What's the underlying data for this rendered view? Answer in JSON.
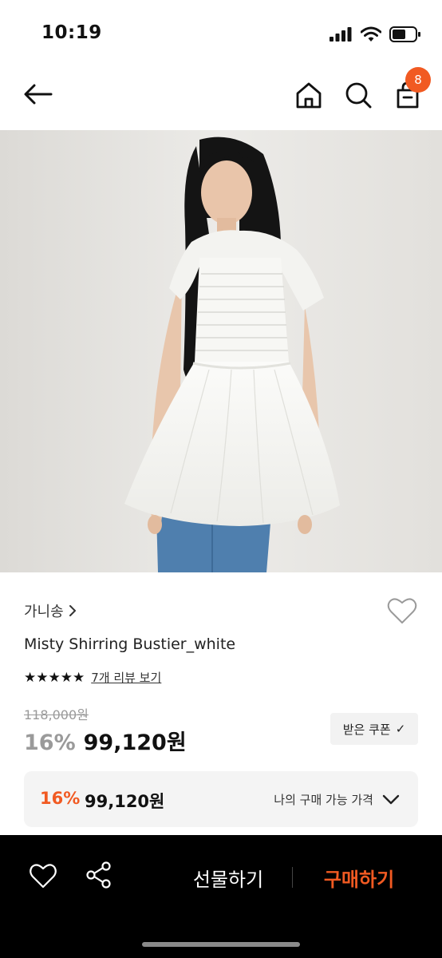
{
  "status_bar": {
    "time": "10:19",
    "icons": [
      "signal-icon",
      "wifi-icon",
      "battery-icon"
    ]
  },
  "nav": {
    "icons": [
      "back-arrow-icon",
      "home-icon",
      "search-icon",
      "shopping-bag-icon"
    ],
    "cart_count": "8"
  },
  "product": {
    "image_label": "product-photo",
    "brand": "가니송",
    "name": "Misty Shirring Bustier_white",
    "rating_stars": "★★★★★",
    "review_link": "7개 리뷰 보기",
    "original_price": "118,000원",
    "discount": "16%",
    "sale_price": "99,120원",
    "coupon_label": "받은 쿠폰",
    "coupon_check": "✓"
  },
  "my_price": {
    "discount": "16%",
    "price": "99,120원",
    "label": "나의 구매 가능 가격"
  },
  "bottom_bar": {
    "gift_label": "선물하기",
    "buy_label": "구매하기"
  },
  "colors": {
    "accent": "#f15a22",
    "bottom_bar_bg": "#000000",
    "muted_text": "#9a9a9a"
  }
}
